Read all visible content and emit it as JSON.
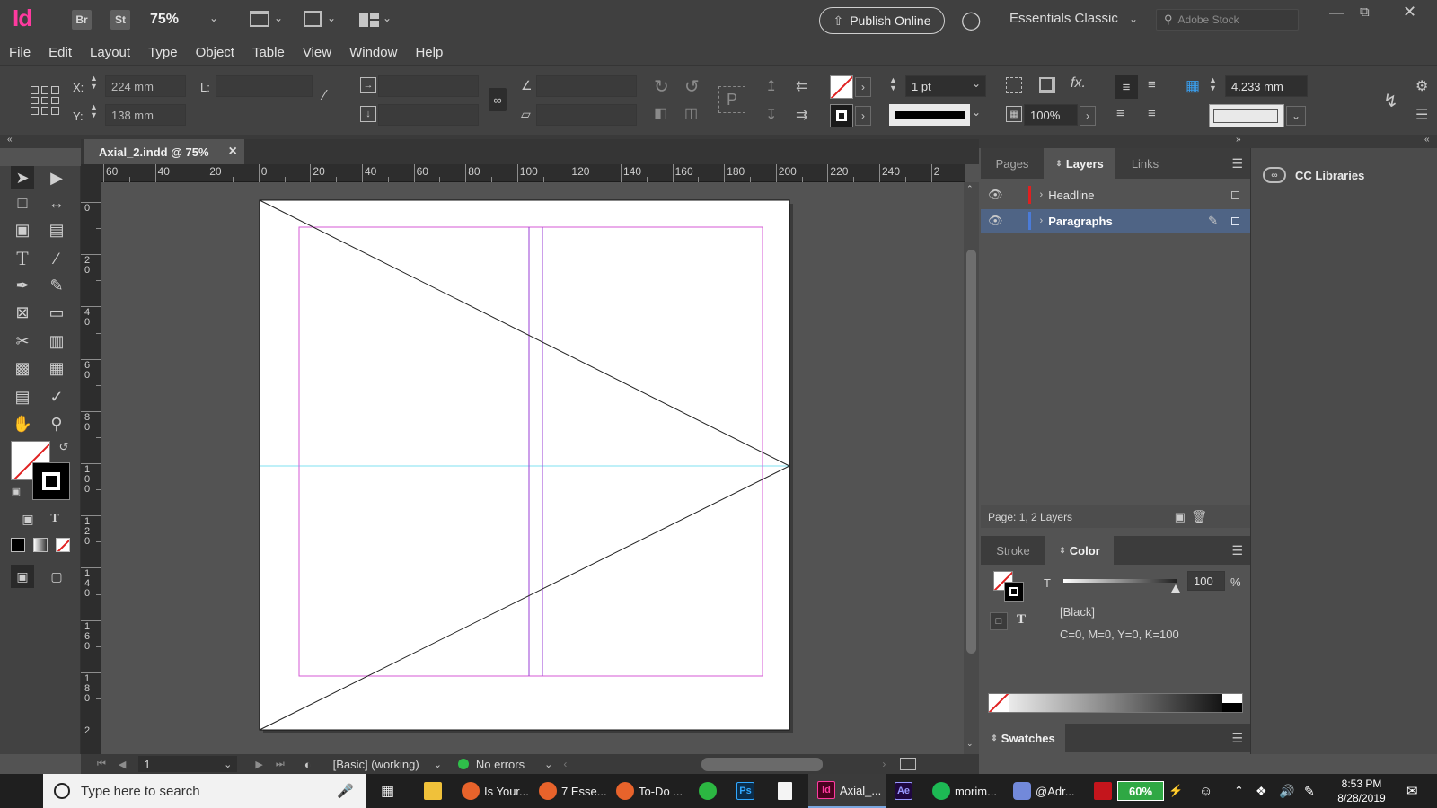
{
  "app": {
    "logo": "Id",
    "bridge_label": "Br",
    "stock_btn_label": "St",
    "zoom": "75%",
    "publish_label": "Publish Online",
    "workspace": "Essentials Classic",
    "stock_placeholder": "Adobe Stock"
  },
  "menu": [
    "File",
    "Edit",
    "Layout",
    "Type",
    "Object",
    "Table",
    "View",
    "Window",
    "Help"
  ],
  "control": {
    "x_label": "X:",
    "x_value": "224 mm",
    "y_label": "Y:",
    "y_value": "138 mm",
    "l_label": "L:",
    "stroke_weight": "1 pt",
    "scale_pct": "100%",
    "offset_value": "4.233 mm"
  },
  "document": {
    "tab_title": "Axial_2.indd @ 75%",
    "close_glyph": "×"
  },
  "rulers": {
    "horizontal": [
      "60",
      "40",
      "20",
      "0",
      "20",
      "40",
      "60",
      "80",
      "100",
      "120",
      "140",
      "160",
      "180",
      "200",
      "220",
      "240",
      "2"
    ],
    "vertical": [
      "0",
      "20",
      "40",
      "60",
      "80",
      "100",
      "120",
      "140",
      "160",
      "180",
      "2"
    ]
  },
  "status": {
    "page_number": "1",
    "style": "[Basic] (working)",
    "preflight": "No errors"
  },
  "panels": {
    "tabs": [
      "Pages",
      "Layers",
      "Links"
    ],
    "active_tab": "Layers",
    "layers": [
      {
        "name": "Headline",
        "color": "#e02020"
      },
      {
        "name": "Paragraphs",
        "color": "#4a7bd9"
      }
    ],
    "layers_footer": "Page: 1, 2 Layers",
    "color_tabs": [
      "Stroke",
      "Color"
    ],
    "tint_label": "T",
    "tint_value": "100",
    "tint_unit": "%",
    "swatch_name": "[Black]",
    "cmyk": "C=0, M=0, Y=0, K=100",
    "swatches_label": "Swatches",
    "cc_libraries": "CC Libraries"
  },
  "taskbar": {
    "search_placeholder": "Type here to search",
    "items": [
      "Is Your...",
      "7 Esse...",
      "To-Do ...",
      "Axial_...",
      "morim...",
      "@Adr..."
    ],
    "battery": "60%",
    "time": "8:53 PM",
    "date": "8/28/2019"
  },
  "colors": {
    "accent_pink": "#ff3a9f",
    "margin_guide": "#d65ad6",
    "column_guide": "#9a3fd6",
    "baseline_guide": "#7fe0f0"
  }
}
